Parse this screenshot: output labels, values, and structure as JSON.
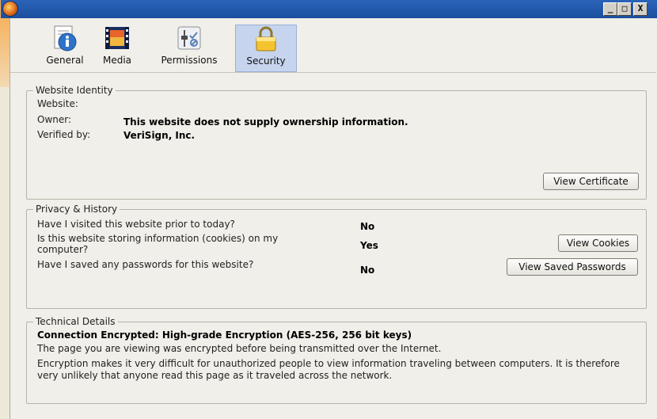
{
  "tabs": [
    {
      "label": "General",
      "icon": "info-icon"
    },
    {
      "label": "Media",
      "icon": "media-icon"
    },
    {
      "label": "Permissions",
      "icon": "permissions-icon"
    },
    {
      "label": "Security",
      "icon": "lock-icon",
      "selected": true
    }
  ],
  "identity": {
    "legend": "Website Identity",
    "website_label": "Website:",
    "website_value": "",
    "owner_label": "Owner:",
    "owner_value": "This website does not supply ownership information.",
    "verified_label": "Verified by:",
    "verified_value": "VeriSign, Inc.",
    "view_certificate": "View Certificate"
  },
  "privacy": {
    "legend": "Privacy & History",
    "q1": "Have I visited this website prior to today?",
    "a1": "No",
    "q2": "Is this website storing information (cookies) on my computer?",
    "a2": "Yes",
    "q3": "Have I saved any passwords for this website?",
    "a3": "No",
    "view_cookies": "View Cookies",
    "view_passwords": "View Saved Passwords"
  },
  "technical": {
    "legend": "Technical Details",
    "headline": "Connection Encrypted: High-grade Encryption (AES-256, 256 bit keys)",
    "line1": "The page you are viewing was encrypted before being transmitted over the Internet.",
    "line2": "Encryption makes it very difficult for unauthorized people to view information traveling between computers. It is therefore very unlikely that anyone read this page as it traveled across the network."
  },
  "window": {
    "min": "_",
    "max": "□",
    "close": "X"
  }
}
